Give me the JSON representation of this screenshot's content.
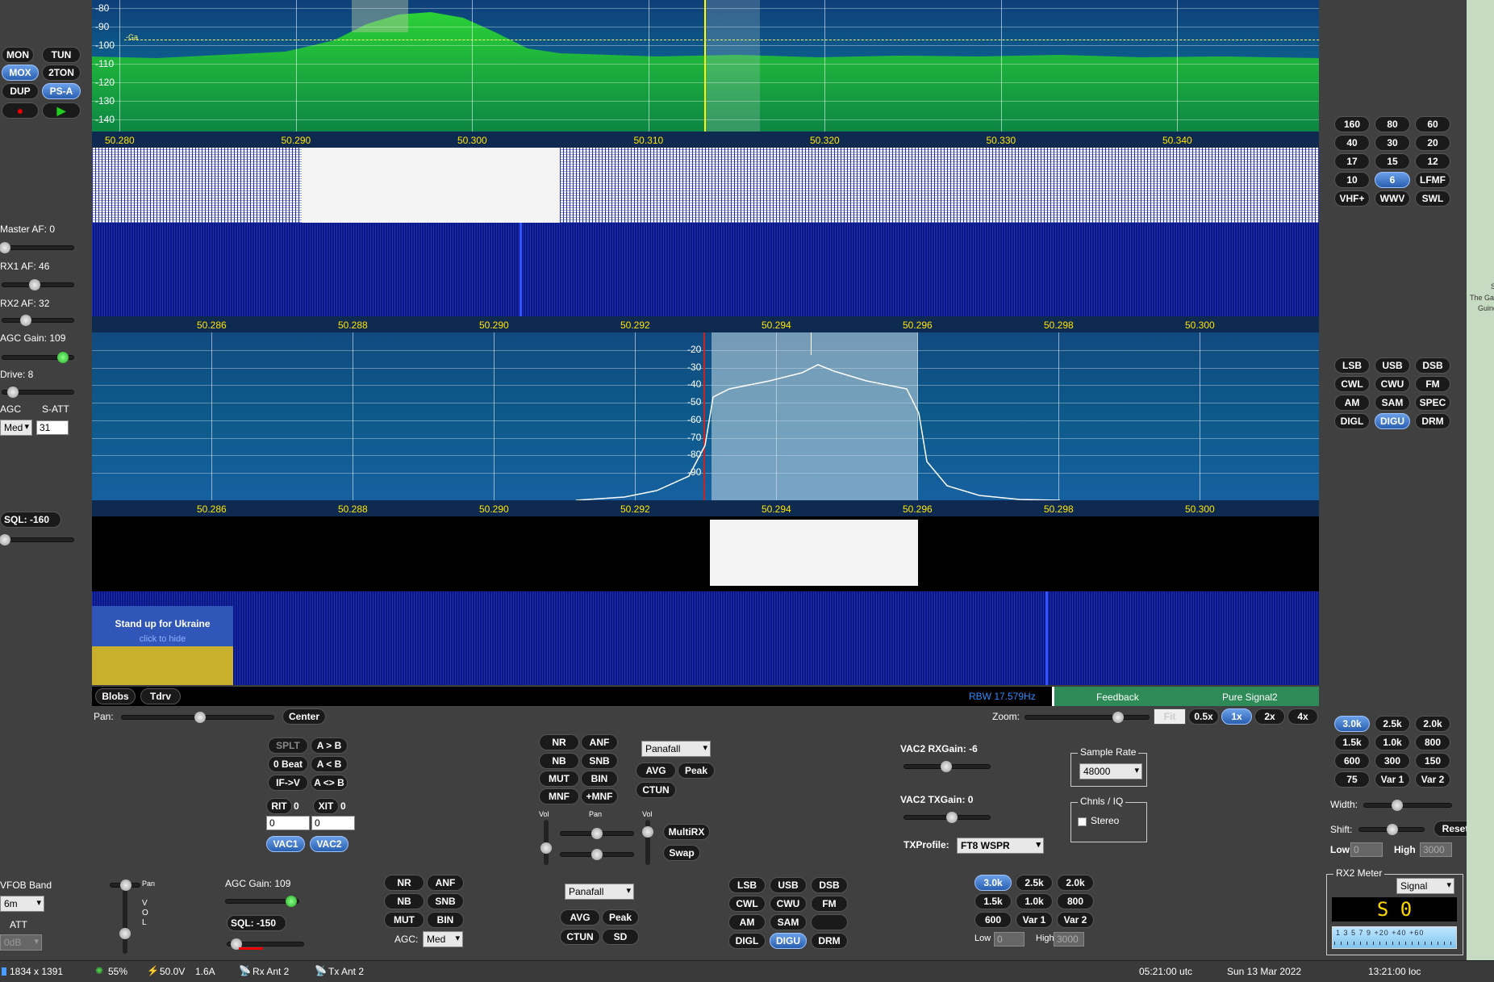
{
  "left_panel": {
    "mon": "MON",
    "tun": "TUN",
    "mox": "MOX",
    "twoton": "2TON",
    "dup": "DUP",
    "psa": "PS-A",
    "master_af": "Master AF:  0",
    "rx1_af": "RX1 AF:  46",
    "rx2_af": "RX2 AF:  32",
    "agc_gain": "AGC Gain:  109",
    "drive": "Drive:  8",
    "agc": "AGC",
    "satt": "S-ATT",
    "agc_value": "Med",
    "satt_value": "31",
    "sql": "SQL:  -160",
    "vfob_band": "VFOB Band",
    "vfob_band_value": "6m",
    "att": "ATT",
    "att_value": "0dB"
  },
  "panadapter1": {
    "db_labels": [
      "-80",
      "-90",
      "-100",
      "-110",
      "-120",
      "-130",
      "-140"
    ],
    "freq_labels": [
      "50.280",
      "50.290",
      "50.300",
      "50.310",
      "50.320",
      "50.330",
      "50.340"
    ],
    "marker": "-Ga"
  },
  "panadapter2": {
    "freq_labels": [
      "50.286",
      "50.288",
      "50.290",
      "50.292",
      "50.294",
      "50.296",
      "50.298",
      "50.300"
    ],
    "db_labels": [
      "-20",
      "-30",
      "-40",
      "-50",
      "-60",
      "-70",
      "-80",
      "-90"
    ]
  },
  "banner": {
    "title": "Stand up for Ukraine",
    "sub": "click to hide"
  },
  "status_strip": {
    "blobs": "Blobs",
    "tdrv": "Tdrv",
    "rbw": "RBW 17.579Hz",
    "feedback": "Feedback",
    "pure_signal": "Pure Signal2"
  },
  "pan_row": {
    "pan": "Pan:",
    "center": "Center",
    "zoom": "Zoom:",
    "fit": "Fit",
    "z05": "0.5x",
    "z1": "1x",
    "z2": "2x",
    "z4": "4x"
  },
  "bands": [
    "160",
    "80",
    "60",
    "40",
    "30",
    "20",
    "17",
    "15",
    "12",
    "10",
    "6",
    "LFMF",
    "VHF+",
    "WWV",
    "SWL"
  ],
  "modes": [
    "LSB",
    "USB",
    "DSB",
    "CWL",
    "CWU",
    "FM",
    "AM",
    "SAM",
    "SPEC",
    "DIGL",
    "DIGU",
    "DRM"
  ],
  "filters": [
    "3.0k",
    "2.5k",
    "2.0k",
    "1.5k",
    "1.0k",
    "800",
    "600",
    "300",
    "150",
    "75",
    "Var 1",
    "Var 2"
  ],
  "right_filter": {
    "width": "Width:",
    "shift": "Shift:",
    "reset": "Reset",
    "low": "Low",
    "low_val": "0",
    "high": "High",
    "high_val": "3000"
  },
  "vfo_ops": {
    "splt": "SPLT",
    "ab": "A > B",
    "beat": "0 Beat",
    "ba": "A < B",
    "ifv": "IF->V",
    "aswap": "A <> B",
    "rit": "RIT",
    "rit_val": "0",
    "xit": "XIT",
    "xit_val": "0",
    "rit_num": "0",
    "xit_num": "0",
    "vac1": "VAC1",
    "vac2": "VAC2"
  },
  "dsp1": {
    "nr": "NR",
    "anf": "ANF",
    "nb": "NB",
    "snb": "SNB",
    "mut": "MUT",
    "bin": "BIN",
    "mnf": "MNF",
    "pmnf": "+MNF",
    "display": "Panafall",
    "avg": "AVG",
    "peak": "Peak",
    "ctun": "CTUN",
    "vol": "Vol",
    "pan": "Pan",
    "vol2": "Vol",
    "multirx": "MultiRX",
    "swap": "Swap"
  },
  "vac": {
    "rx_gain": "VAC2 RXGain:  -6",
    "tx_gain": "VAC2 TXGain:  0",
    "tx_profile": "TXProfile:",
    "tx_profile_value": "FT8 WSPR",
    "sample_rate": "Sample Rate",
    "sample_rate_value": "48000",
    "chnls": "Chnls / IQ",
    "stereo": "Stereo"
  },
  "rx2": {
    "pan": "Pan",
    "vol": "V\nO\nL",
    "agc_gain": "AGC Gain:  109",
    "sql": "SQL:  -150",
    "nr": "NR",
    "anf": "ANF",
    "nb": "NB",
    "snb": "SNB",
    "mut": "MUT",
    "bin": "BIN",
    "agc": "AGC:",
    "agc_value": "Med",
    "display": "Panafall",
    "avg": "AVG",
    "peak": "Peak",
    "ctun": "CTUN",
    "sd": "SD",
    "modes": [
      "LSB",
      "USB",
      "DSB",
      "CWL",
      "CWU",
      "FM",
      "AM",
      "SAM",
      "",
      "DIGL",
      "DIGU",
      "DRM"
    ],
    "filters": [
      "3.0k",
      "2.5k",
      "2.0k",
      "1.5k",
      "1.0k",
      "800",
      "600",
      "Var 1",
      "Var 2"
    ],
    "low": "Low",
    "low_val": "0",
    "high": "High",
    "high_val": "3000"
  },
  "meter": {
    "title": "RX2 Meter",
    "mode": "Signal",
    "reading": "S 0",
    "scale": "1 3 5 7 9 +20 +40 +60"
  },
  "statusbar": {
    "res": "1834 x 1391",
    "cpu": "55%",
    "volt": "50.0V",
    "amp": "1.6A",
    "rx_ant": "Rx Ant 2",
    "tx_ant": "Tx Ant 2",
    "utc": "05:21:00 utc",
    "date": "Sun 13 Mar 2022",
    "local": "13:21:00 loc"
  },
  "map": {
    "text1": "Se",
    "text2": "The Ga",
    "text3": "Guine"
  },
  "colors": {
    "accent": "#2a5fb0",
    "spectrum": "#22cc22",
    "wf_blue": "#0a1a8a",
    "feedback": "#2e8b57"
  }
}
